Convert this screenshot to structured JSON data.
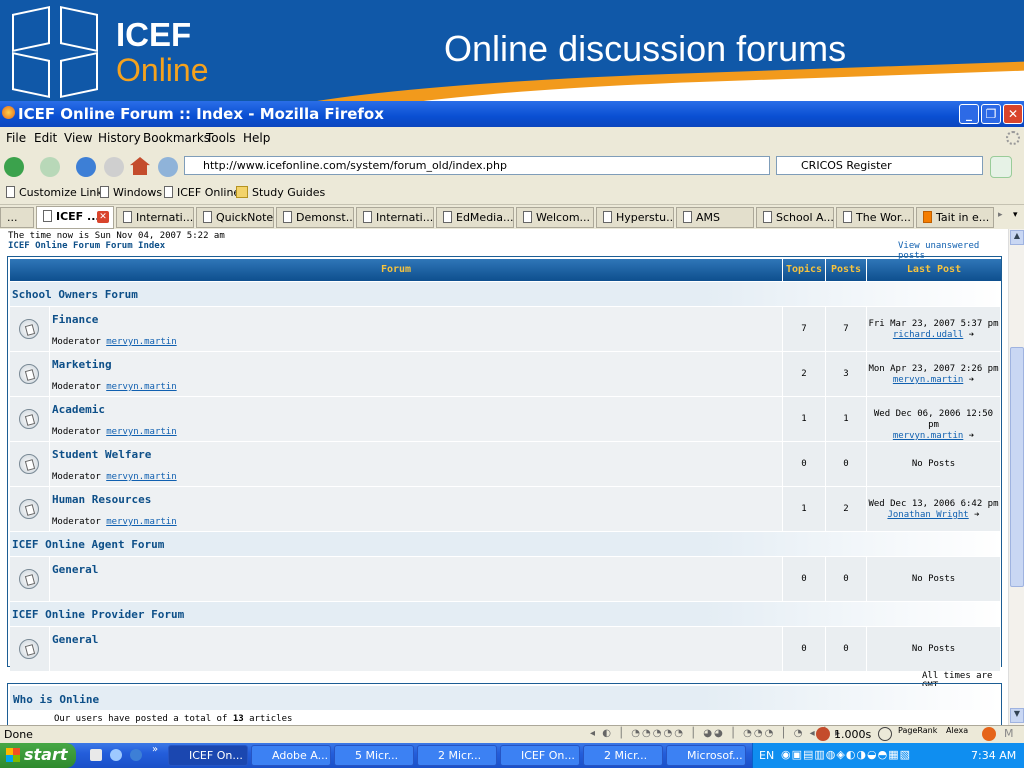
{
  "banner": {
    "logo_line1": "ICEF",
    "logo_line2": "Online",
    "slide_title": "Online discussion forums"
  },
  "window": {
    "title": "ICEF Online Forum :: Index - Mozilla Firefox",
    "minimize": "_",
    "maximize": "❐",
    "close": "✕"
  },
  "menu": [
    "File",
    "Edit",
    "View",
    "History",
    "Bookmarks",
    "Tools",
    "Help"
  ],
  "nav": {
    "url": "http://www.icefonline.com/system/forum_old/index.php",
    "search_value": "CRICOS Register"
  },
  "bookmarks": [
    "Customize Links",
    "Windows",
    "ICEF Online",
    "Study Guides"
  ],
  "tabs": [
    "...",
    "ICEF ...",
    "Internati...",
    "QuickNote",
    "Demonst...",
    "Internati...",
    "EdMedia...",
    "Welcom...",
    "Hyperstu...",
    "AMS",
    "School A...",
    "The Wor...",
    "Tait in e..."
  ],
  "page": {
    "time_now": "The time now is Sun Nov 04, 2007 5:22 am",
    "index_link": "ICEF Online Forum Forum Index",
    "unanswered": "View unanswered posts",
    "headers": {
      "forum": "Forum",
      "topics": "Topics",
      "posts": "Posts",
      "last_post": "Last Post"
    },
    "moderator_label": "Moderator",
    "categories": [
      {
        "name": "School Owners Forum",
        "forums": [
          {
            "name": "Finance",
            "moderator": "mervyn.martin",
            "topics": "7",
            "posts": "7",
            "last_date": "Fri Mar 23, 2007 5:37 pm",
            "last_user": "richard.udall"
          },
          {
            "name": "Marketing",
            "moderator": "mervyn.martin",
            "topics": "2",
            "posts": "3",
            "last_date": "Mon Apr 23, 2007 2:26 pm",
            "last_user": "mervyn.martin"
          },
          {
            "name": "Academic",
            "moderator": "mervyn.martin",
            "topics": "1",
            "posts": "1",
            "last_date": "Wed Dec 06, 2006 12:50 pm",
            "last_user": "mervyn.martin"
          },
          {
            "name": "Student Welfare",
            "moderator": "mervyn.martin",
            "topics": "0",
            "posts": "0",
            "last_date": "No Posts",
            "last_user": ""
          },
          {
            "name": "Human Resources",
            "moderator": "mervyn.martin",
            "topics": "1",
            "posts": "2",
            "last_date": "Wed Dec 13, 2006 6:42 pm",
            "last_user": "Jonathan Wright"
          }
        ]
      },
      {
        "name": "ICEF Online Agent Forum",
        "forums": [
          {
            "name": "General",
            "moderator": "",
            "topics": "0",
            "posts": "0",
            "last_date": "No Posts",
            "last_user": ""
          }
        ]
      },
      {
        "name": "ICEF Online Provider Forum",
        "forums": [
          {
            "name": "General",
            "moderator": "",
            "topics": "0",
            "posts": "0",
            "last_date": "No Posts",
            "last_user": ""
          }
        ]
      }
    ],
    "timezone": "All times are GMT",
    "who_online": "Who is Online",
    "articles_text_pre": "Our users have posted a total of",
    "articles_count": "13",
    "articles_text_post": "articles"
  },
  "status": {
    "text": "Done",
    "timing": "1.000s",
    "pagerank": "PageRank",
    "alexa": "Alexa"
  },
  "taskbar": {
    "start": "start",
    "tasks": [
      "ICEF On...",
      "Adobe A...",
      "5 Micr...",
      "2 Micr...",
      "ICEF On...",
      "2 Micr...",
      "Microsof..."
    ],
    "lang": "EN",
    "clock": "7:34 AM"
  }
}
